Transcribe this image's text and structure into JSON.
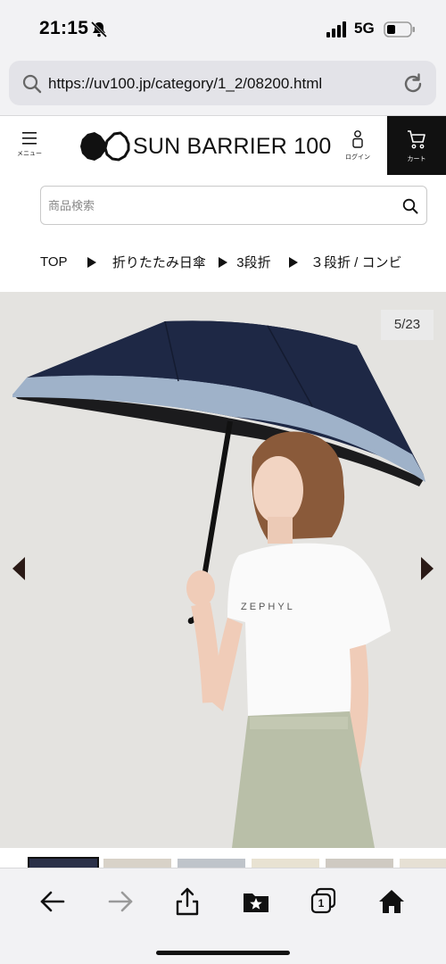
{
  "status_bar": {
    "time": "21:15",
    "network": "5G",
    "icons": [
      "bell-slash-icon",
      "signal-icon",
      "battery-icon"
    ]
  },
  "browser": {
    "url": "https://uv100.jp/category/1_2/08200.html",
    "toolbar_icons": [
      "back-icon",
      "forward-icon",
      "share-icon",
      "bookmarks-icon",
      "tabs-icon",
      "home-icon"
    ],
    "tab_count": "1"
  },
  "header": {
    "menu_label": "メニュー",
    "logo_text": "SUN BARRIER 100",
    "login_label": "ログイン",
    "cart_label": "カート"
  },
  "search": {
    "placeholder": "商品検索"
  },
  "breadcrumb": {
    "items": [
      "TOP",
      "折りたたみ日傘",
      "3段折",
      "３段折 / コンビ"
    ]
  },
  "gallery": {
    "counter": "5/23",
    "shirt_text": "ZEPHYL"
  },
  "colors": {
    "cart_bg": "#111111",
    "umbrella_navy": "#1e2845",
    "umbrella_trim": "#9fb2c9",
    "photo_bg": "#e4e3e0"
  }
}
